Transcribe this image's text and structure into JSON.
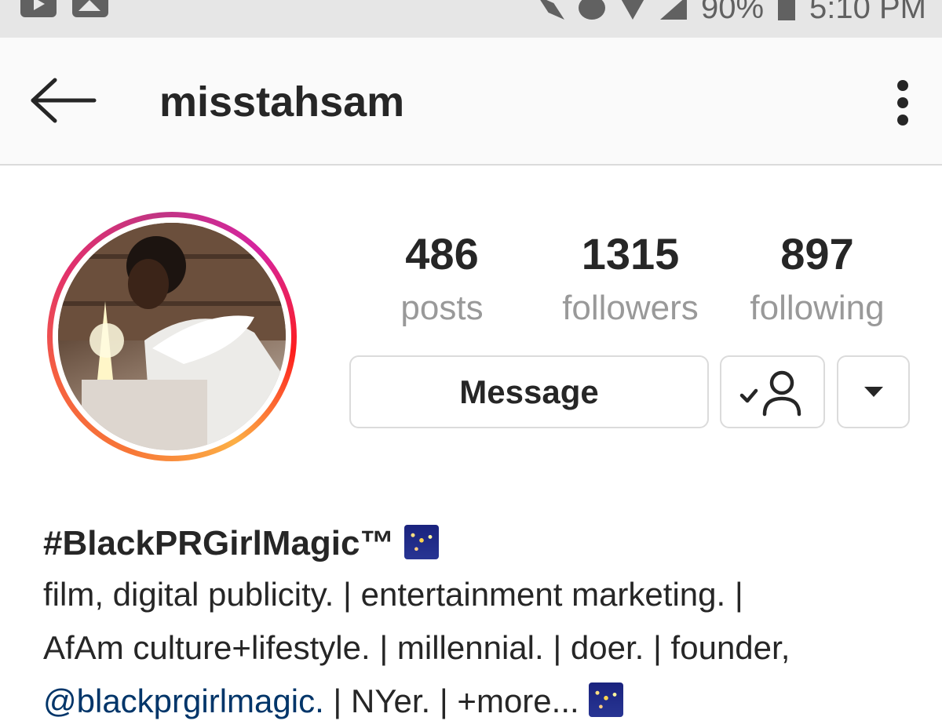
{
  "status_bar": {
    "battery": "90%",
    "time": "5:10 PM",
    "icons": [
      "youtube-icon",
      "gallery-icon",
      "mute-icon",
      "alarm-icon",
      "wifi-icon",
      "signal-icon",
      "battery-icon"
    ]
  },
  "header": {
    "username": "misstahsam",
    "icons": [
      "back-arrow-icon",
      "more-options-icon"
    ]
  },
  "stats": [
    {
      "value": "486",
      "label": "posts"
    },
    {
      "value": "1315",
      "label": "followers"
    },
    {
      "value": "897",
      "label": "following"
    }
  ],
  "actions": {
    "message_label": "Message",
    "icons": [
      "following-check-user-icon",
      "dropdown-caret-icon"
    ]
  },
  "bio": {
    "name": "#BlackPRGirlMagic™",
    "line1": "film, digital publicity. | entertainment marketing. |",
    "line2": "AfAm culture+lifestyle. | millennial. | doer. | founder,",
    "mention": "@blackprgirlmagic.",
    "line3_rest": " | NYer. | +more...",
    "emoji": "fireworks-emoji-icon"
  },
  "colors": {
    "text": "#262626",
    "muted": "#999999",
    "mention": "#003569",
    "border": "#dbdbdb",
    "status_bar": "#e6e6e6",
    "header": "#fafafa"
  }
}
